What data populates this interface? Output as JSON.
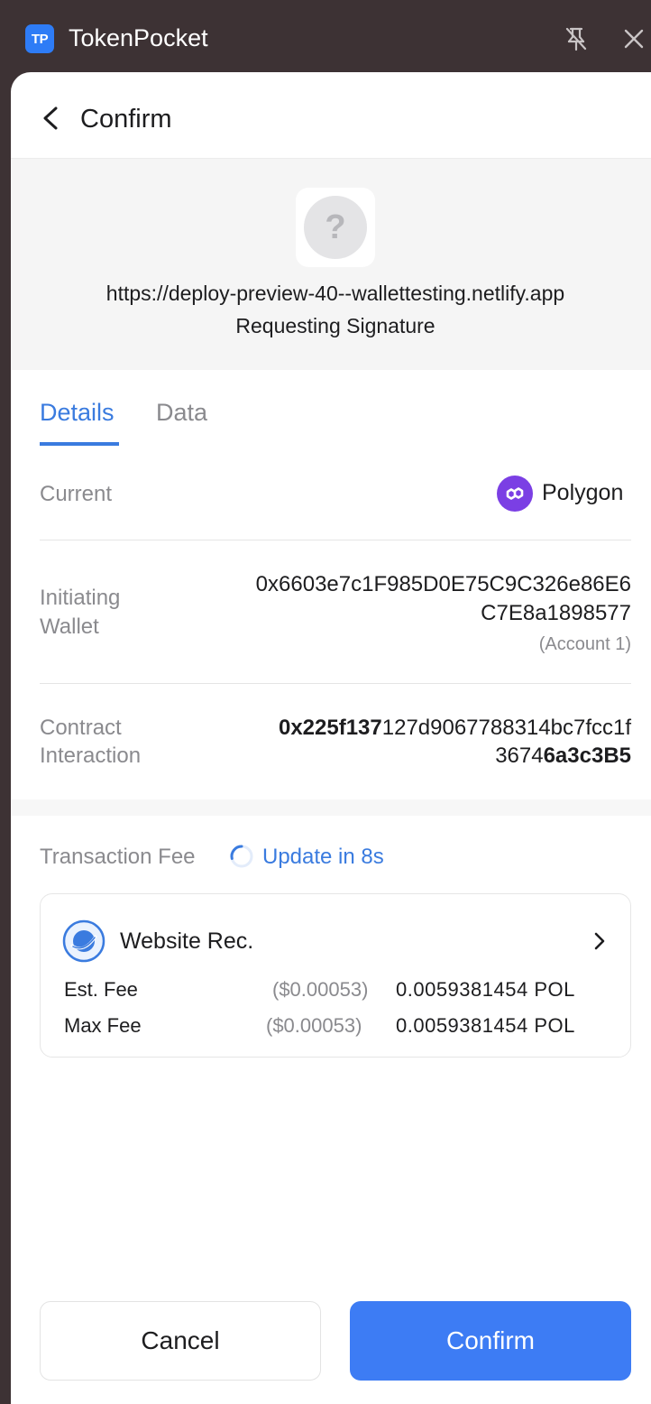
{
  "window": {
    "app_logo_text": "TP",
    "app_name": "TokenPocket"
  },
  "header": {
    "title": "Confirm"
  },
  "site": {
    "icon_glyph": "?",
    "url": "https://deploy-preview-40--wallettesting.netlify.app",
    "subtitle": "Requesting Signature"
  },
  "tabs": [
    {
      "label": "Details",
      "active": true
    },
    {
      "label": "Data",
      "active": false
    }
  ],
  "details": {
    "network_label": "Current",
    "network_value": "Polygon",
    "wallet_label_line1": "Initiating",
    "wallet_label_line2": "Wallet",
    "wallet_address_line1": "0x6603e7c1F985D0E75C9C326e86E6",
    "wallet_address_line2": "C7E8a1898577",
    "wallet_account": "(Account 1)",
    "contract_label_line1": "Contract",
    "contract_label_line2": "Interaction",
    "contract_line1_bold": "0x225f137",
    "contract_line1_rest": "127d9067788314bc7fcc1f",
    "contract_line2_rest": "3674",
    "contract_line2_bold": "6a3c3B5"
  },
  "fee": {
    "label": "Transaction Fee",
    "update_text": "Update in 8s",
    "card_title": "Website Rec.",
    "est_label": "Est. Fee",
    "est_usd": "($0.00053)",
    "est_amount": "0.0059381454  POL",
    "max_label": "Max Fee",
    "max_usd": "($0.00053)",
    "max_amount": "0.0059381454  POL"
  },
  "buttons": {
    "cancel": "Cancel",
    "confirm": "Confirm"
  },
  "colors": {
    "accent": "#3a7bdf",
    "confirm_button": "#3d7cf4",
    "polygon": "#7b3fe4",
    "titlebar": "#3d3234"
  }
}
